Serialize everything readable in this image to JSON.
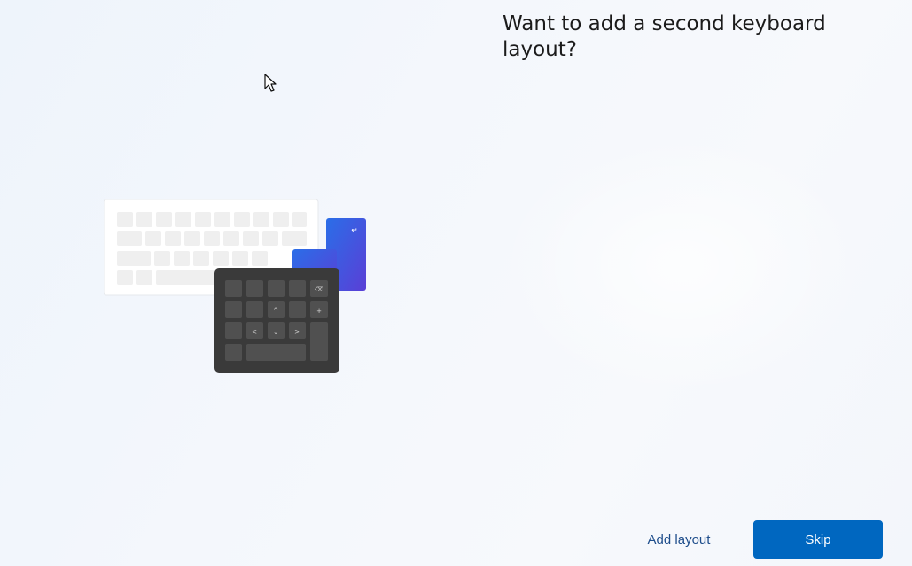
{
  "page": {
    "title": "Want to add a second keyboard layout?"
  },
  "illustration": {
    "keyboard_color": "#ffffff",
    "numpad_color": "#3a3a3a",
    "accent_key_color": "#2f58d8",
    "numpad_key_glyphs": [
      "⌫",
      "+",
      "^",
      "<",
      "⌄",
      ">"
    ],
    "enter_glyph": "↵"
  },
  "footer": {
    "secondary_label": "Add layout",
    "primary_label": "Skip",
    "primary_color": "#0067c0"
  }
}
